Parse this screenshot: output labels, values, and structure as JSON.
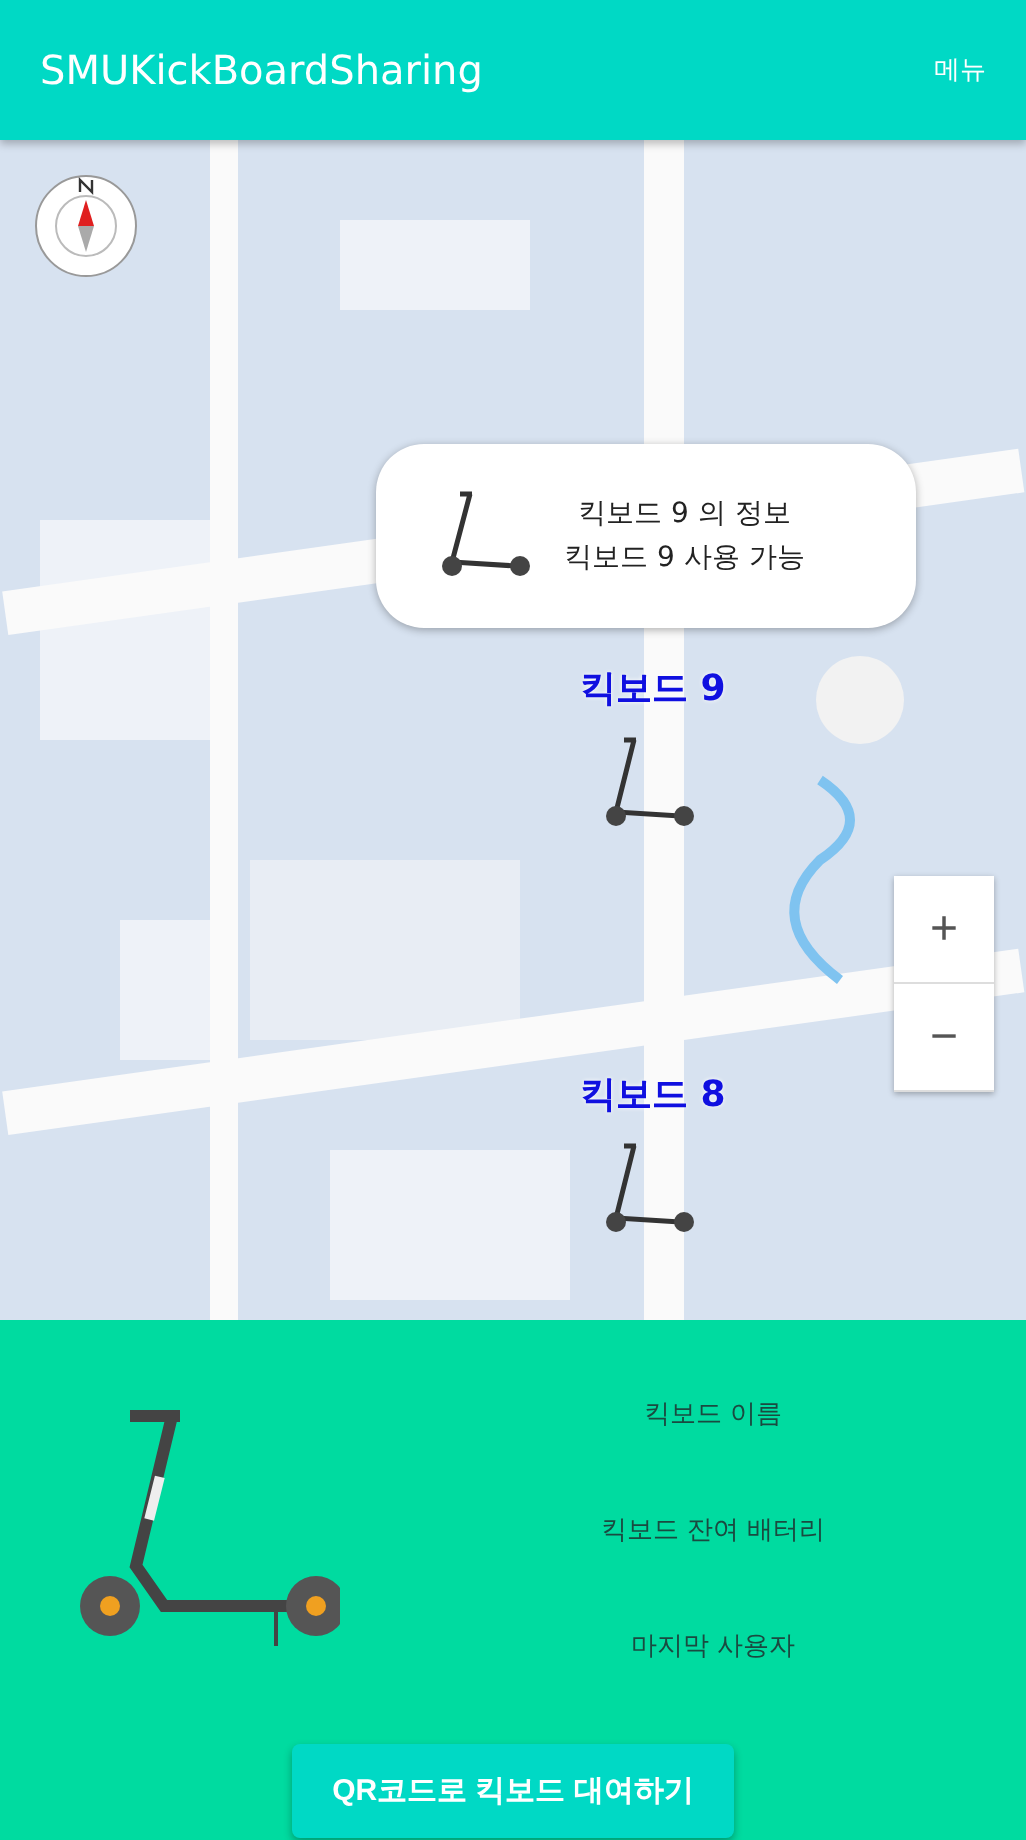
{
  "app_bar": {
    "title": "SMUKickBoardSharing",
    "menu": "메뉴"
  },
  "map": {
    "markers": [
      {
        "label": "킥보드 9",
        "info": {
          "lines": [
            "킥보드 9 의 정보",
            "킥보드 9 사용 가능"
          ]
        }
      },
      {
        "label": "킥보드 8"
      }
    ],
    "zoom_controls": [
      "+",
      "−"
    ]
  },
  "details": {
    "fields": [
      "킥보드 이름",
      "킥보드 잔여 배터리",
      "마지막 사용자"
    ],
    "rent_button": "QR코드로 킥보드 대여하기"
  }
}
